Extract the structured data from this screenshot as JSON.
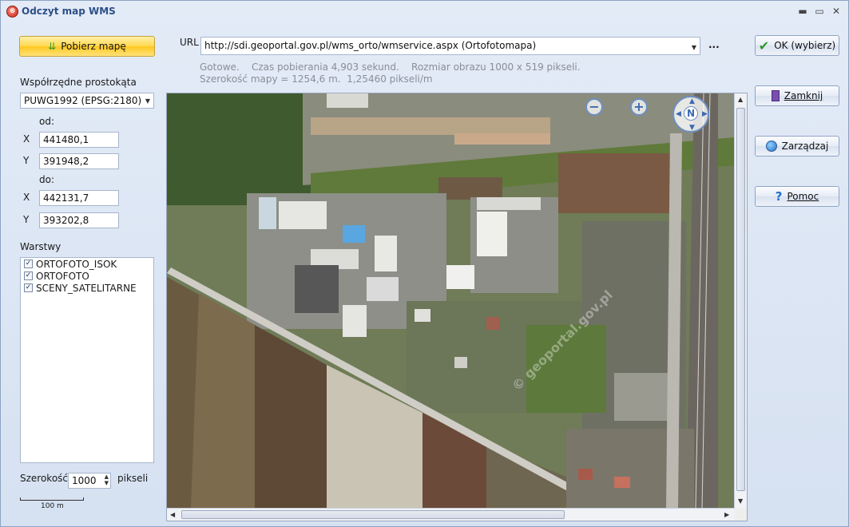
{
  "window": {
    "title": "Odczyt map WMS",
    "controls": {
      "minimize": "▬",
      "maximize": "▭",
      "close": "✕"
    }
  },
  "left": {
    "download_button": "Pobierz mapę",
    "coords_label": "Współrzędne prostokąta",
    "crs_value": "PUWG1992 (EPSG:2180)",
    "from_label": "od:",
    "to_label": "do:",
    "x_label": "X",
    "y_label": "Y",
    "from_x": "441480,1",
    "from_y": "391948,2",
    "to_x": "442131,7",
    "to_y": "393202,8",
    "layers_label": "Warstwy",
    "layers": [
      {
        "name": "ORTOFOTO_ISOK",
        "checked": true
      },
      {
        "name": "ORTOFOTO",
        "checked": true
      },
      {
        "name": "SCENY_SATELITARNE",
        "checked": true
      }
    ],
    "width_label": "Szerokość",
    "width_value": "1000",
    "width_unit": "pikseli",
    "scale_label": "100 m"
  },
  "top": {
    "url_label": "URL",
    "url_value": "http://sdi.geoportal.gov.pl/wms_orto/wmservice.aspx (Ortofotomapa)",
    "more_button": "...",
    "status_line1": "Gotowe.    Czas pobierania 4,903 sekund.    Rozmiar obrazu 1000 x 519 pikseli.",
    "status_line2": "Szerokość mapy = 1254,6 m.  1,25460 pikseli/m"
  },
  "right": {
    "ok_button": "OK (wybierz)",
    "close_button": "Zamknij",
    "manage_button": "Zarządzaj",
    "help_button": "Pomoc"
  },
  "map": {
    "zoom_out": "−",
    "zoom_in": "+",
    "compass_n": "N",
    "watermark": "© geoportal.gov.pl"
  }
}
